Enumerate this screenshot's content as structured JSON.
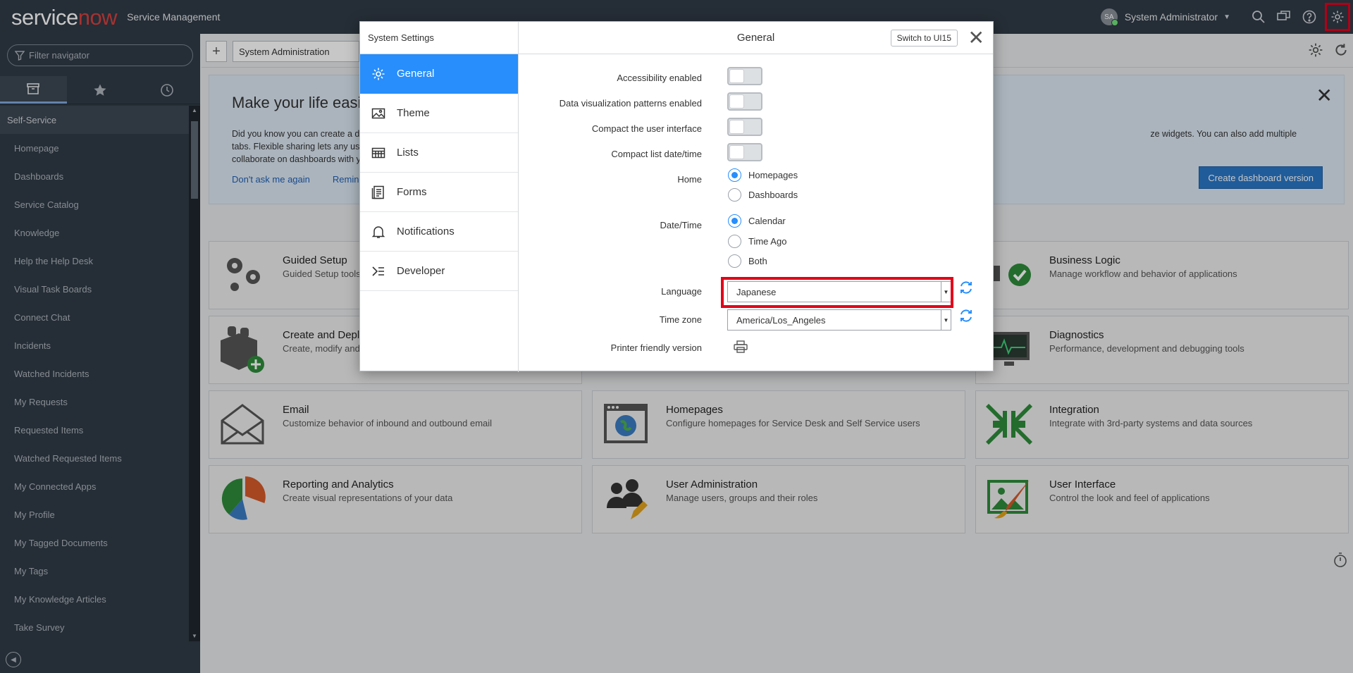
{
  "banner": {
    "logo_service": "service",
    "logo_now": "now",
    "app_title": "Service Management",
    "user_initials": "SA",
    "user_name": "System Administrator",
    "icons": [
      "search-icon",
      "chat-icon",
      "help-icon",
      "gear-icon"
    ]
  },
  "navigator": {
    "filter_placeholder": "Filter navigator",
    "tabs": [
      "archive-icon",
      "star-icon",
      "history-icon"
    ],
    "section": "Self-Service",
    "items": [
      "Homepage",
      "Dashboards",
      "Service Catalog",
      "Knowledge",
      "Help the Help Desk",
      "Visual Task Boards",
      "Connect Chat",
      "Incidents",
      "Watched Incidents",
      "My Requests",
      "Requested Items",
      "Watched Requested Items",
      "My Connected Apps",
      "My Profile",
      "My Tagged Documents",
      "My Tags",
      "My Knowledge Articles",
      "Take Survey"
    ]
  },
  "content": {
    "tab_label": "System Administration",
    "info": {
      "title": "Make your life easi",
      "text_left": "Did you know you can create a da",
      "text_left2": "collaborate on dashboards with yo",
      "text_right": "ze widgets. You can also add multiple tabs. Flexible sharing lets any user view and",
      "link_dont": "Don't ask me again",
      "link_remind": "Remind",
      "button": "Create dashboard version"
    },
    "cards": [
      {
        "title": "Guided Setup",
        "desc": "Guided Setup tools"
      },
      {
        "title": "Business Logic",
        "desc": "Manage workflow and behavior of applications"
      },
      {
        "title": "Create and Deplo",
        "desc": "Create, modify and d"
      },
      {
        "title": "Diagnostics",
        "desc": "Performance, development and debugging tools"
      },
      {
        "title": "Email",
        "desc": "Customize behavior of inbound and outbound email"
      },
      {
        "title": "Homepages",
        "desc": "Configure homepages for Service Desk and Self Service users"
      },
      {
        "title": "Integration",
        "desc": "Integrate with 3rd-party systems and data sources"
      },
      {
        "title": "Reporting and Analytics",
        "desc": "Create visual representations of your data"
      },
      {
        "title": "User Administration",
        "desc": "Manage users, groups and their roles"
      },
      {
        "title": "User Interface",
        "desc": "Control the look and feel of applications"
      }
    ]
  },
  "modal": {
    "left_title": "System Settings",
    "menu": [
      "General",
      "Theme",
      "Lists",
      "Forms",
      "Notifications",
      "Developer"
    ],
    "active_menu": "General",
    "title": "General",
    "switch_button": "Switch to UI15",
    "toggles": [
      {
        "label": "Accessibility enabled",
        "on": false
      },
      {
        "label": "Data visualization patterns enabled",
        "on": false
      },
      {
        "label": "Compact the user interface",
        "on": false
      },
      {
        "label": "Compact list date/time",
        "on": false
      }
    ],
    "home": {
      "label": "Home",
      "options": [
        "Homepages",
        "Dashboards"
      ],
      "selected": "Homepages"
    },
    "datetime": {
      "label": "Date/Time",
      "options": [
        "Calendar",
        "Time Ago",
        "Both"
      ],
      "selected": "Calendar"
    },
    "language": {
      "label": "Language",
      "value": "Japanese"
    },
    "timezone": {
      "label": "Time zone",
      "value": "America/Los_Angeles"
    },
    "printer": {
      "label": "Printer friendly version"
    }
  },
  "colors": {
    "banner": "#303a46",
    "active_menu": "#278efc",
    "highlight": "#e3001b",
    "primary_button": "#2a76c6"
  }
}
